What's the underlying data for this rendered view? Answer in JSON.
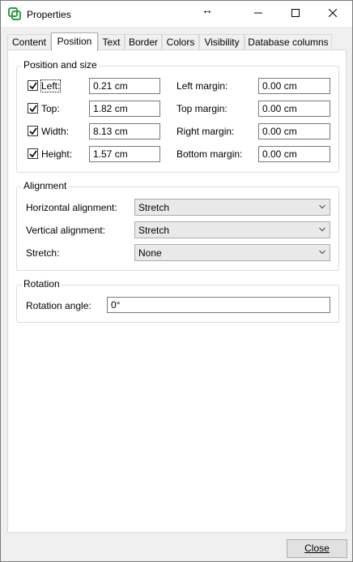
{
  "window": {
    "title": "Properties",
    "resize_glyph": "↔",
    "icons": {
      "app": "app-logo-icon",
      "minimize": "minimize-icon",
      "maximize": "maximize-icon",
      "close": "close-icon"
    }
  },
  "tabs": [
    {
      "label": "Content"
    },
    {
      "label": "Position",
      "active": true
    },
    {
      "label": "Text"
    },
    {
      "label": "Border"
    },
    {
      "label": "Colors"
    },
    {
      "label": "Visibility"
    },
    {
      "label": "Database columns"
    }
  ],
  "position_and_size": {
    "title": "Position and size",
    "fields": [
      {
        "label": "Left:",
        "checked": true,
        "value": "0.21 cm"
      },
      {
        "label": "Top:",
        "checked": true,
        "value": "1.82 cm"
      },
      {
        "label": "Width:",
        "checked": true,
        "value": "8.13 cm"
      },
      {
        "label": "Height:",
        "checked": true,
        "value": "1.57 cm"
      }
    ],
    "margins": [
      {
        "label": "Left margin:",
        "value": "0.00 cm"
      },
      {
        "label": "Top margin:",
        "value": "0.00 cm"
      },
      {
        "label": "Right margin:",
        "value": "0.00 cm"
      },
      {
        "label": "Bottom margin:",
        "value": "0.00 cm"
      }
    ]
  },
  "alignment": {
    "title": "Alignment",
    "rows": [
      {
        "label": "Horizontal alignment:",
        "value": "Stretch"
      },
      {
        "label": "Vertical alignment:",
        "value": "Stretch"
      },
      {
        "label": "Stretch:",
        "value": "None"
      }
    ]
  },
  "rotation": {
    "title": "Rotation",
    "label": "Rotation angle:",
    "value": "0°"
  },
  "footer": {
    "close_label": "Close"
  },
  "colors": {
    "accent_green": "#2e9e45",
    "window_bg": "#f0f0f0",
    "panel_bg": "#ffffff"
  }
}
